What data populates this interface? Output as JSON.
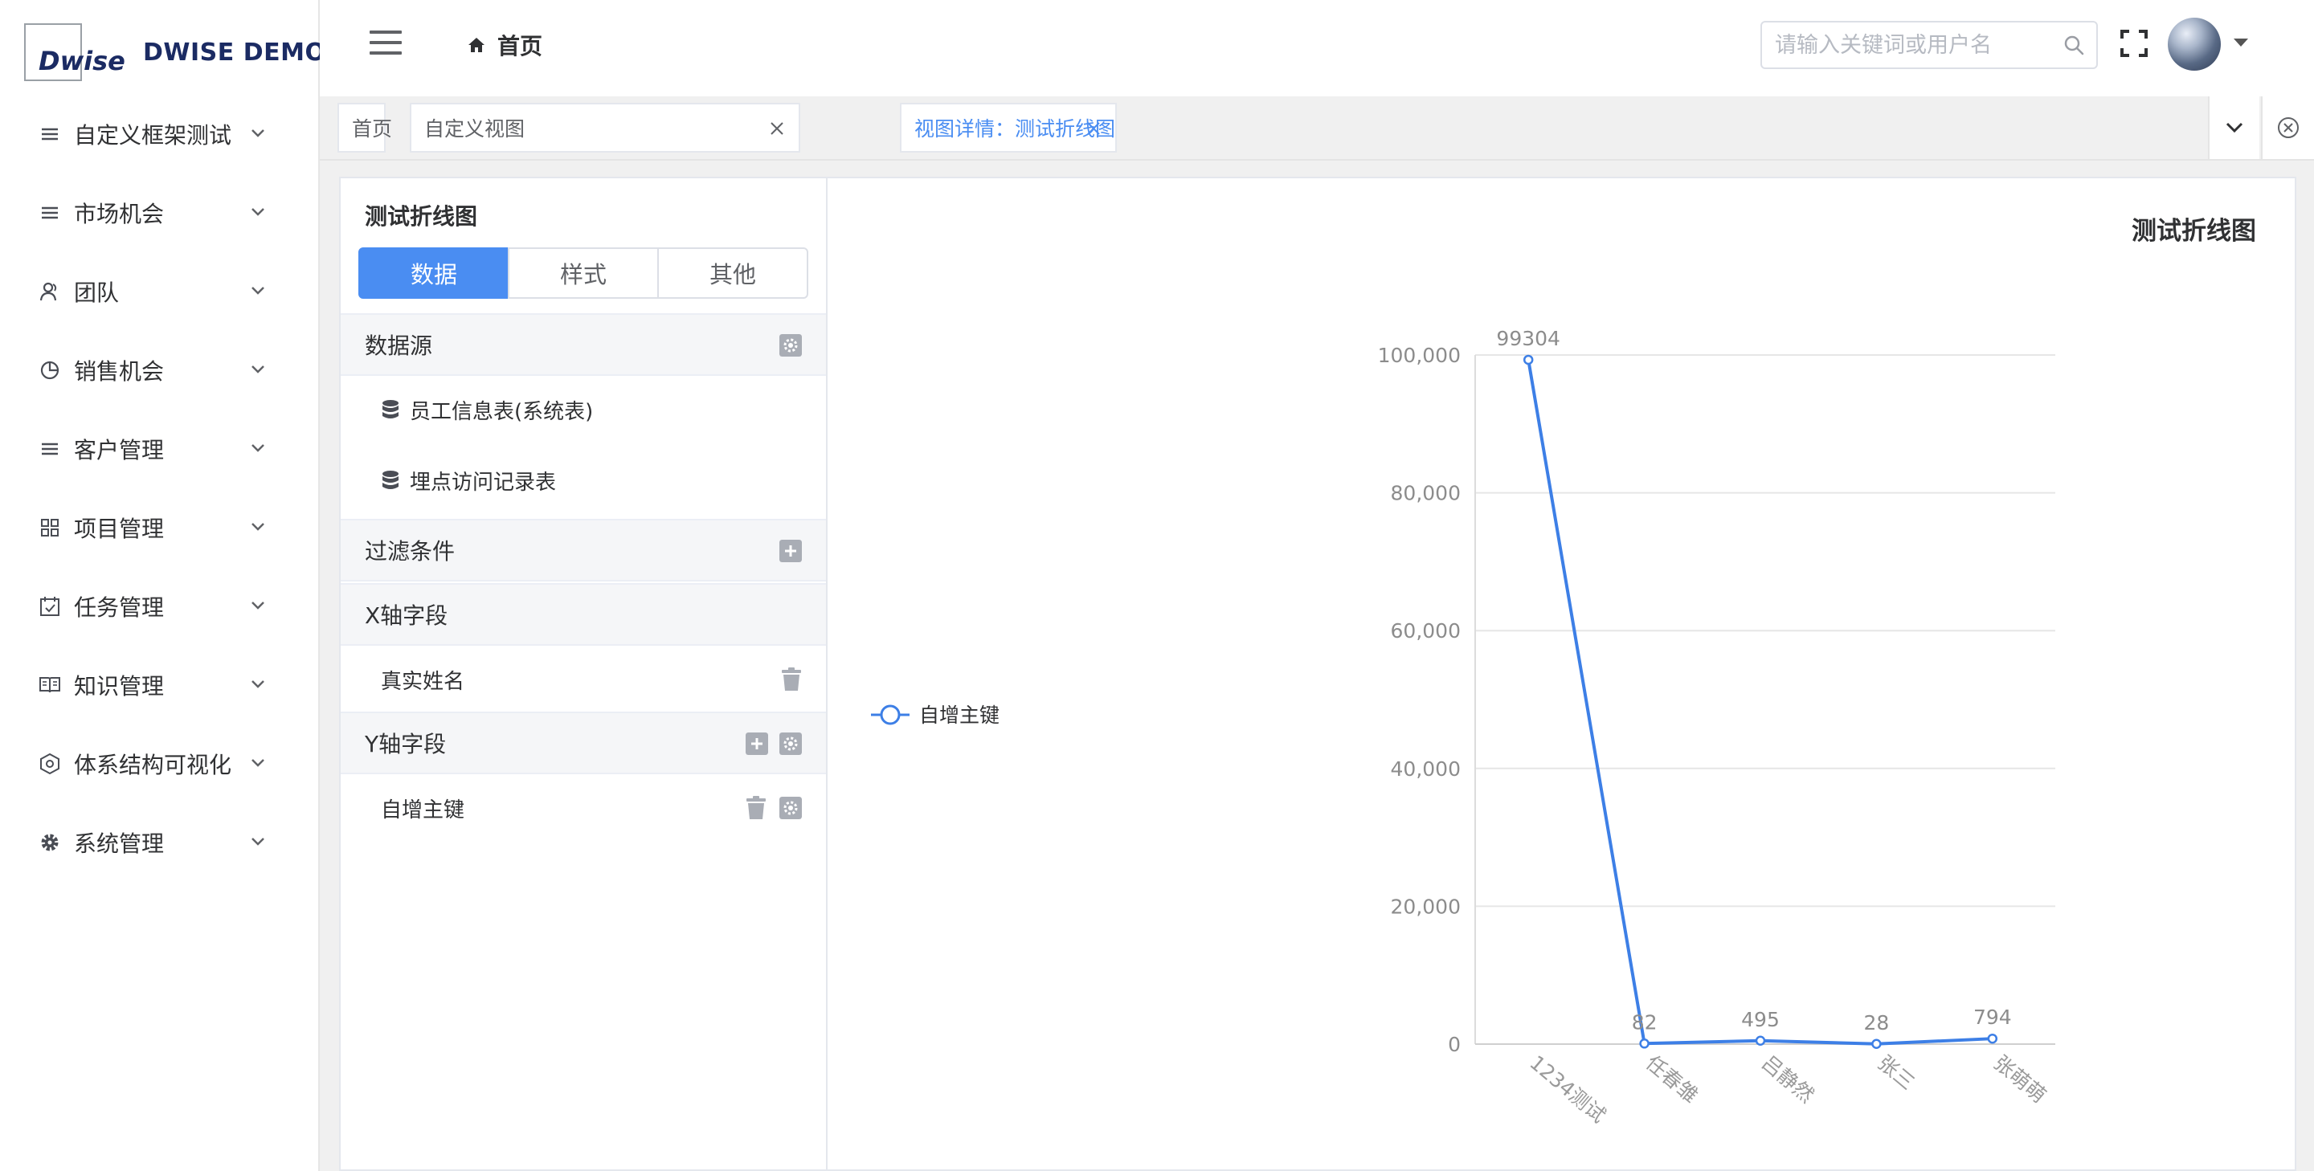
{
  "app": {
    "logo_mark": "Dwise",
    "logo_text": "DWISE DEMO"
  },
  "sidebar": {
    "items": [
      {
        "label": "自定义框架测试",
        "icon": "list-icon"
      },
      {
        "label": "市场机会",
        "icon": "list-icon"
      },
      {
        "label": "团队",
        "icon": "users-icon"
      },
      {
        "label": "销售机会",
        "icon": "pie-icon"
      },
      {
        "label": "客户管理",
        "icon": "list-icon"
      },
      {
        "label": "项目管理",
        "icon": "grid-icon"
      },
      {
        "label": "任务管理",
        "icon": "calendar-check-icon"
      },
      {
        "label": "知识管理",
        "icon": "book-icon"
      },
      {
        "label": "体系结构可视化",
        "icon": "hexagon-icon"
      },
      {
        "label": "系统管理",
        "icon": "gear-icon"
      }
    ]
  },
  "header": {
    "breadcrumb": "首页",
    "search_placeholder": "请输入关键词或用户名"
  },
  "tags": [
    {
      "label": "首页",
      "closable": false,
      "active": false
    },
    {
      "label": "自定义视图",
      "closable": true,
      "active": false
    },
    {
      "label": "视图详情：测试折线图",
      "closable": true,
      "active": true
    }
  ],
  "panel": {
    "title": "测试折线图",
    "tabs": [
      "数据",
      "样式",
      "其他"
    ],
    "active_tab": 0,
    "datasource_label": "数据源",
    "datasources": [
      "员工信息表(系统表)",
      "埋点访问记录表"
    ],
    "filter_label": "过滤条件",
    "x_label": "X轴字段",
    "x_fields": [
      "真实姓名"
    ],
    "y_label": "Y轴字段",
    "y_fields": [
      "自增主键"
    ]
  },
  "chart_data": {
    "type": "line",
    "title": "测试折线图",
    "categories": [
      "1234测试",
      "任春雏",
      "吕静然",
      "张三",
      "张萌萌"
    ],
    "series": [
      {
        "name": "自增主键",
        "values": [
          99304,
          82,
          495,
          28,
          794
        ],
        "color": "#3d7fe6"
      }
    ],
    "ylim": [
      0,
      100000
    ],
    "yticks": [
      0,
      20000,
      40000,
      60000,
      80000,
      100000
    ],
    "ytick_labels": [
      "0",
      "20,000",
      "40,000",
      "60,000",
      "80,000",
      "100,000"
    ],
    "data_labels": [
      "99304",
      "82",
      "495",
      "28",
      "794"
    ],
    "grid": true,
    "legend": "left"
  },
  "colors": {
    "accent": "#4a8df2",
    "series": "#3d7fe6"
  }
}
